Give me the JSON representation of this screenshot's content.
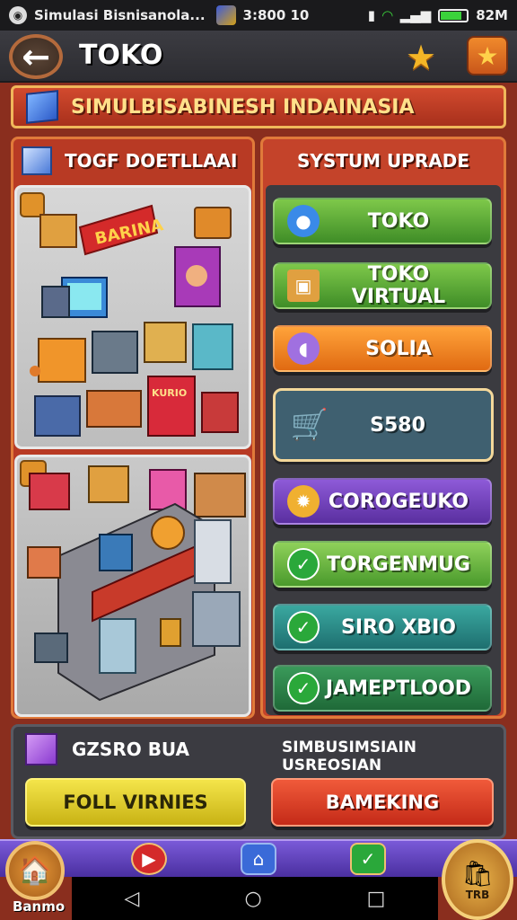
{
  "status_bar": {
    "app_title": "Simulasi Bisnisanola...",
    "time": "3:800 10",
    "battery": "82M",
    "battery_level": 0.82
  },
  "header": {
    "back_icon": "arrow-left-icon",
    "title": "TOKO",
    "star_icon": "star-icon"
  },
  "banner": {
    "text": "SIMULBISABINESH INDAINASIA"
  },
  "left_panel": {
    "title": "TOGF DOETLLAAI",
    "illus1_sign": "BARINA",
    "illus1_item": "KURIO"
  },
  "right_panel": {
    "title": "SYSTUM UPRADE",
    "buttons": [
      {
        "label": "TOKO",
        "icon": "chat-bubble-icon",
        "color": "#4fa832"
      },
      {
        "label": "TOKO VIRTUAL",
        "icon": "box-icon",
        "color": "#4fa832"
      },
      {
        "label": "SOLIA",
        "icon": "pill-icon",
        "color": "#f08a22"
      },
      {
        "label": "S580",
        "icon": "cart-icon",
        "color": "#3f6070"
      },
      {
        "label": "COROGEUKO",
        "icon": "badge-icon",
        "color": "#7a45c4"
      },
      {
        "label": "TORGENMUG",
        "icon": "check-icon",
        "color": "#6ab840"
      },
      {
        "label": "SIRO XBIO",
        "icon": "check-icon",
        "color": "#2a8a85"
      },
      {
        "label": "JAMEPTLOOD",
        "icon": "check-icon",
        "color": "#2a7a48"
      }
    ]
  },
  "bottom_panel": {
    "left_label": "GZSRO BUA",
    "right_label": "SIMBUSIMSIAIN USREOSIAN",
    "yellow_button": "FOLL VIRNIES",
    "red_button": "BAMEKING"
  },
  "bottom_nav": {
    "left_label": "Banmo",
    "right_label": "TRB"
  },
  "colors": {
    "frame": "#8a2e1e",
    "banner_text": "#ffe08a",
    "accent_orange": "#e07a3a"
  }
}
